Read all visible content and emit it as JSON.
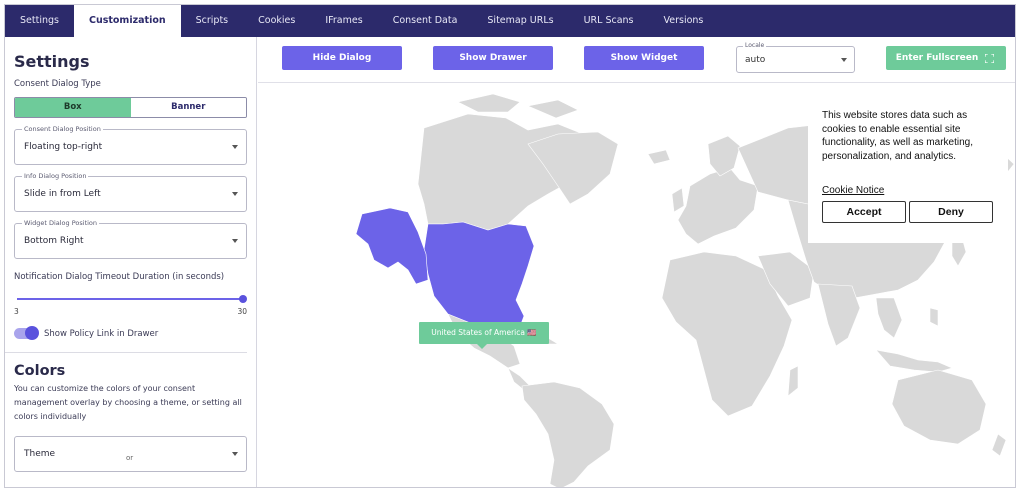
{
  "nav": {
    "tabs": [
      "Settings",
      "Customization",
      "Scripts",
      "Cookies",
      "IFrames",
      "Consent Data",
      "Sitemap URLs",
      "URL Scans",
      "Versions"
    ],
    "active": "Customization"
  },
  "sidebar": {
    "title": "Settings",
    "dialog_type_label": "Consent Dialog Type",
    "dialog_type_options": [
      "Box",
      "Banner"
    ],
    "dialog_type_selected": "Box",
    "consent_position": {
      "caption": "Consent Dialog Position",
      "value": "Floating top-right"
    },
    "info_position": {
      "caption": "Info Dialog Position",
      "value": "Slide in from Left"
    },
    "widget_position": {
      "caption": "Widget Dialog Position",
      "value": "Bottom Right"
    },
    "timeout_label": "Notification Dialog Timeout Duration (in seconds)",
    "timeout_min": "3",
    "timeout_max": "30",
    "timeout_level": 1.0,
    "policy_toggle_label": "Show Policy Link in Drawer",
    "policy_toggle_on": true,
    "colors_title": "Colors",
    "colors_desc": "You can customize the colors of your consent management overlay by choosing a theme, or setting all colors individually",
    "theme_value": "Theme",
    "or_text": "or"
  },
  "toolbar": {
    "hide_dialog": "Hide Dialog",
    "show_drawer": "Show Drawer",
    "show_widget": "Show Widget",
    "locale_caption": "Locale",
    "locale_value": "auto",
    "fullscreen": "Enter Fullscreen"
  },
  "map": {
    "tooltip": "United States of America 🇺🇸",
    "highlight_color": "#6c63e8",
    "land_color": "#d9d9d9"
  },
  "consent": {
    "message": "This website stores data such as cookies to enable essential site functionality, as well as marketing, personalization, and analytics.",
    "link": "Cookie Notice",
    "accept": "Accept",
    "deny": "Deny"
  },
  "colors": {
    "nav_bg": "#2c2a6b",
    "accent_purple": "#6c63e8",
    "accent_green": "#6ecb9a"
  }
}
